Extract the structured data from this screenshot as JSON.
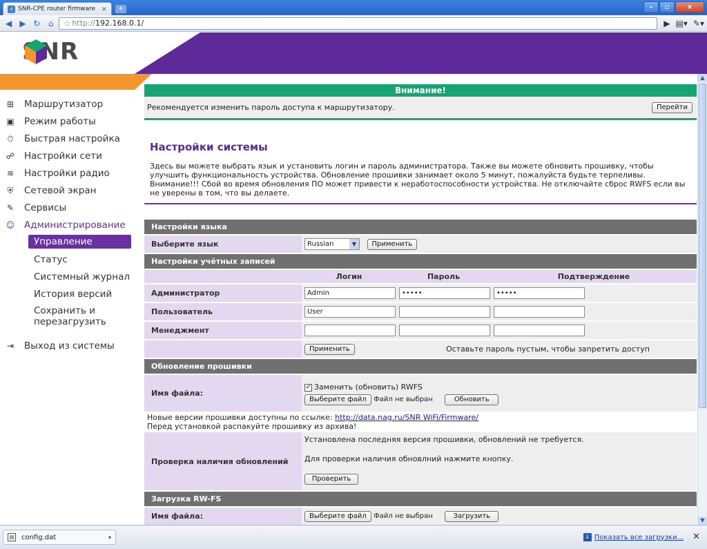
{
  "browser": {
    "tab_title": "SNR-CPE router firmware",
    "url_scheme": "http://",
    "url_host": "192.168.0.1/"
  },
  "brand": {
    "logo_text": "SNR",
    "purple": "#5e2a9a",
    "orange": "#f5962a",
    "green": "#16a572"
  },
  "sidebar": {
    "items": [
      {
        "label": "Маршрутизатор",
        "icon": "router-icon"
      },
      {
        "label": "Режим работы",
        "icon": "mode-icon"
      },
      {
        "label": "Быстрая настройка",
        "icon": "stopwatch-icon"
      },
      {
        "label": "Настройки сети",
        "icon": "network-icon"
      },
      {
        "label": "Настройки радио",
        "icon": "wifi-icon"
      },
      {
        "label": "Сетевой экран",
        "icon": "shield-icon"
      },
      {
        "label": "Сервисы",
        "icon": "wrench-icon"
      },
      {
        "label": "Администрирование",
        "icon": "admin-icon"
      }
    ],
    "sub_items": [
      "Управление",
      "Статус",
      "Системный журнал",
      "История версий",
      "Сохранить и перезагрузить"
    ],
    "logout": "Выход из системы"
  },
  "alert": {
    "title": "Внимание!",
    "text": "Рекомендуется изменить пароль доступа к маршрутизатору.",
    "button": "Перейти"
  },
  "page": {
    "title": "Настройки системы",
    "description": "Здесь вы можете выбрать язык и установить логин и пароль администратора. Также вы можете обновить прошивку, чтобы улучшить функциональность устройства. Обновление прошивки занимает около 5 минут, пожалуйста будьте терпеливы. Внимание!!! Сбой во время обновления ПО может привести к неработоспособности устройства. Не отключайте сброс RWFS если вы не уверены в том, что вы делаете."
  },
  "language": {
    "header": "Настройки языка",
    "label": "Выберите язык",
    "selected": "Russian",
    "apply": "Применить"
  },
  "accounts": {
    "header": "Настройки учётных записей",
    "col_login": "Логин",
    "col_password": "Пароль",
    "col_confirm": "Подтверждение",
    "rows": [
      {
        "label": "Администратор",
        "login": "Admin",
        "password": "•••••",
        "confirm": "•••••"
      },
      {
        "label": "Пользователь",
        "login": "User",
        "password": "",
        "confirm": ""
      },
      {
        "label": "Менеджмент",
        "login": "",
        "password": "",
        "confirm": ""
      }
    ],
    "apply": "Применить",
    "hint": "Оставьте пароль пустым, чтобы запретить доступ"
  },
  "firmware": {
    "header": "Обновление прошивки",
    "file_label": "Имя файла:",
    "checkbox_label": "Заменить (обновить) RWFS",
    "choose_file": "Выберите файл",
    "no_file": "Файл не выбран",
    "update": "Обновить",
    "note_prefix": "Новые версии прошивки доступны по ссылке:",
    "note_link": "http://data.nag.ru/SNR WiFi/Firmware/",
    "note_line2": "Перед установкой распакуйте прошивку из архива!",
    "check_label": "Проверка наличия обновлений",
    "check_status": "Установлена последняя версия прошивки, обновлений не требуется.",
    "check_hint": "Для проверки наличия обновлний нажмите кнопку.",
    "check_button": "Проверить"
  },
  "rwfs": {
    "header": "Загрузка RW-FS",
    "file_label": "Имя файла:",
    "choose_file": "Выберите файл",
    "no_file": "Файл не выбран",
    "upload": "Загрузить"
  },
  "downloads": {
    "file": "config.dat",
    "show_all": "Показать все загрузки..."
  }
}
